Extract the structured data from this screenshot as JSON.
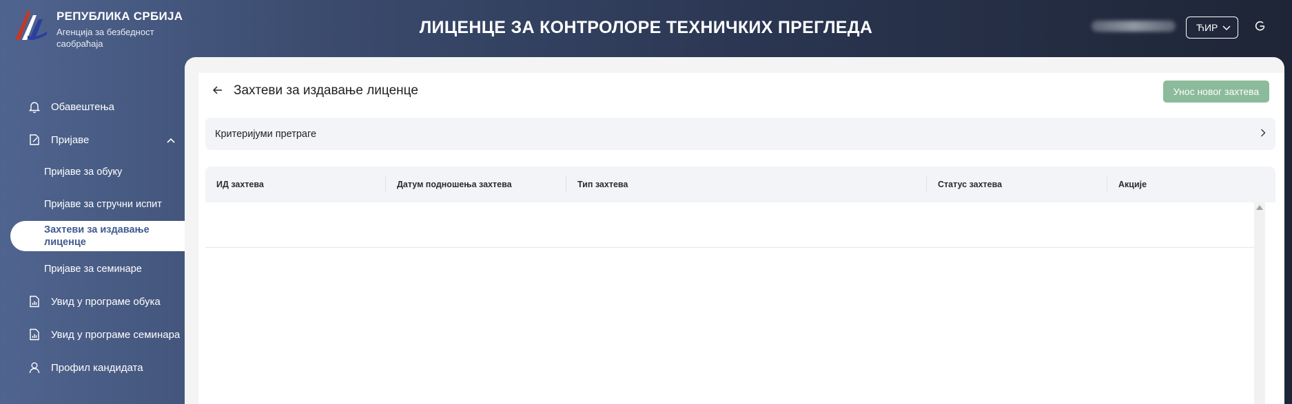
{
  "brand": {
    "title": "РЕПУБЛИКА СРБИЈА",
    "subtitle": "Агенција за безбедност саобраћаја",
    "logo_colors": [
      "#c0392b",
      "#2c3e9e",
      "#ffffff"
    ]
  },
  "header": {
    "app_title": "ЛИЦЕНЦЕ ЗА КОНТРОЛОРЕ ТЕХНИЧКИХ ПРЕГЛЕДА",
    "language": "ЋИР",
    "language_icon": "chevron-down-icon",
    "logout_icon": "logout-icon"
  },
  "sidebar": {
    "items": [
      {
        "label": "Обавештења",
        "icon": "bell-icon"
      },
      {
        "label": "Пријаве",
        "icon": "edit-document-icon",
        "expanded": true,
        "children": [
          {
            "label": "Пријаве за обуку"
          },
          {
            "label": "Пријаве за стручни испит"
          },
          {
            "label": "Захтеви за издавање лиценце",
            "active": true
          },
          {
            "label": "Пријаве за семинаре"
          }
        ]
      },
      {
        "label": "Увид у програме обука",
        "icon": "chart-document-icon"
      },
      {
        "label": "Увид у програме семинара",
        "icon": "chart-document-icon"
      },
      {
        "label": "Профил кандидата",
        "icon": "user-icon"
      }
    ]
  },
  "main": {
    "page_title": "Захтеви за издавање лиценце",
    "new_request_label": "Унос новог захтева",
    "search_criteria_label": "Критеријуми претраге",
    "table": {
      "columns": [
        "ИД захтева",
        "Датум подношења захтева",
        "Тип захтева",
        "Статус захтева",
        "Акције"
      ],
      "rows": []
    }
  },
  "colors": {
    "accent": "#3f5a8e",
    "primary_button": "#8cbb9b",
    "panel_bg": "#f4f4f5",
    "header_bg": "#f3f4f8"
  }
}
